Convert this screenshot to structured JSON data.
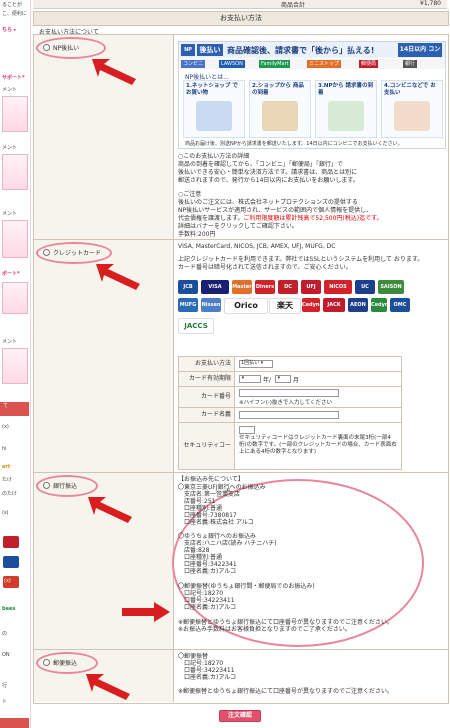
{
  "sidebar": {
    "texts": [
      "ることが",
      "こ、便利に",
      "ちら ▸",
      "サポート*",
      "メント",
      "メント",
      "メント",
      "ポート*",
      "メント",
      "(x)",
      "hi",
      "ert",
      "たけ",
      "のたけ",
      "(s)",
      "(x)",
      "の",
      "ON",
      "bees",
      "行",
      "ト"
    ],
    "section_label": "て"
  },
  "total": {
    "label": "商品合計",
    "value": "¥1,780"
  },
  "section_title": "お支払い方法",
  "section_subtitle": "お支払い方法について",
  "methods": {
    "np": {
      "label": "NP後払い",
      "banner": {
        "logo": "NP",
        "brand": "後払い",
        "headline": "商品確認後、請求書で「後から」払える!",
        "days": "14日以内 コンビニ等",
        "chips": [
          "コンビニ",
          "LAWSON",
          "FamilyMart",
          "ミニストップ",
          "郵便局",
          "銀行"
        ],
        "subtitle": "NP後払いとは…",
        "steps": [
          "1.ネットショップ で お買い物",
          "2.ショップから 商品の到着",
          "3.NPから 請求書の到着",
          "4.コンビニなどで お支払い"
        ],
        "note": "商品お届け後、別送NPから請求書を郵送いたします。14日以内にコンビニでお支払いください。"
      },
      "desc_lines": [
        "○このお支払い方法の詳細",
        "商品の到着を確認してから、「コンビニ」「郵便局」「銀行」で",
        "後払いできる安心・簡単な決済方法です。請求書は、商品とは別に",
        "郵送されますので、発行から14日以内にお支払いをお願いします。",
        "",
        "○ご注意",
        "後払いのご注文には、株式会社ネットプロテクションズの提供する",
        "NP後払いサービスが適用され、サービスの範囲内で個人情報を提供し、",
        "代金債権を譲渡します。",
        "詳細はバナーをクリックしてご確認下さい。"
      ],
      "desc_red": "ご利用限度額は累計残高で52,500円(税込)迄です。",
      "fee": "手数料:200円"
    },
    "credit": {
      "label": "クレジットカード",
      "brands_line": "VISA, MasterCard, NICOS, JCB, AMEX, UFJ, MUFG, DC",
      "intro_lines": [
        "上記クレジットカードを利用できます。弊社ではSSLというシステムを利用して おります。",
        "カード番号は暗号化されて送信されますので、ご安心ください。"
      ],
      "cards": [
        "JCB",
        "VISA",
        "Master",
        "Diners",
        "DC",
        "UFJ",
        "NICOS",
        "UC",
        "SAISON",
        "MUFG",
        "Nissen",
        "Orico",
        "楽天",
        "Cedyna",
        "JACK",
        "AEON",
        "Cedyna",
        "OMC",
        "JACCS"
      ],
      "form": {
        "payment_times_label": "お支払い方法",
        "payment_times_value": "1回払い",
        "expiry_label": "カード有効期限",
        "expiry_year_unit": "年/",
        "expiry_month_unit": "月",
        "card_number_label": "カード番号",
        "card_number_hint": "※ハイフン(-)抜きで入力してください",
        "card_name_label": "カード名義",
        "security_label": "セキュリティコード",
        "security_hint": "セキュリティコードはクレジットカード裏面の末尾3桁(一部4桁)の数字です。(一部のクレジットカードの場合、カード表面右上にある4桁の数字となります)"
      }
    },
    "bank": {
      "label": "銀行振込",
      "lines": [
        "【お振込み先について】",
        "〇東京三菱UFJ銀行へのお振込み",
        "　支店名:第一営業支店",
        "　店番号:251",
        "　口座種別:普通",
        "　口座番号:7380817",
        "　口座名義:株式会社 アルコ",
        "",
        "〇ゆうちょ銀行へのお振込み",
        "　支店名:ハニハ店(読み ハチニハチ)",
        "　店番:828",
        "　口座種別:普通",
        "　口座番号:3422341",
        "　口座名義:カ)アルコ",
        "",
        "〇郵便振替(ゆうちょ銀行間・郵便局でのお振込み)",
        "　口記号:18270",
        "　口番号:34223411",
        "　口座名義:カ)アルコ",
        "",
        "※郵便振替とゆうちょ銀行振込にて口座番号が異なりますのでご注意ください。",
        "※お振込み手数料はお客様負担となりますのでご了承ください。"
      ]
    },
    "postal": {
      "label": "郵便振込",
      "lines": [
        "〇郵便振替",
        "　口記号:18270",
        "　口番号:34223411",
        "　口座名義:カ)アルコ",
        "",
        "※郵便振替とゆうちょ銀行振込にて口座番号が異なりますのでご注意ください。"
      ]
    }
  },
  "submit_label": "注文確認",
  "colors": {
    "accent": "#e2506c",
    "oval": "#e8879c",
    "arrow": "#d81e1e"
  }
}
